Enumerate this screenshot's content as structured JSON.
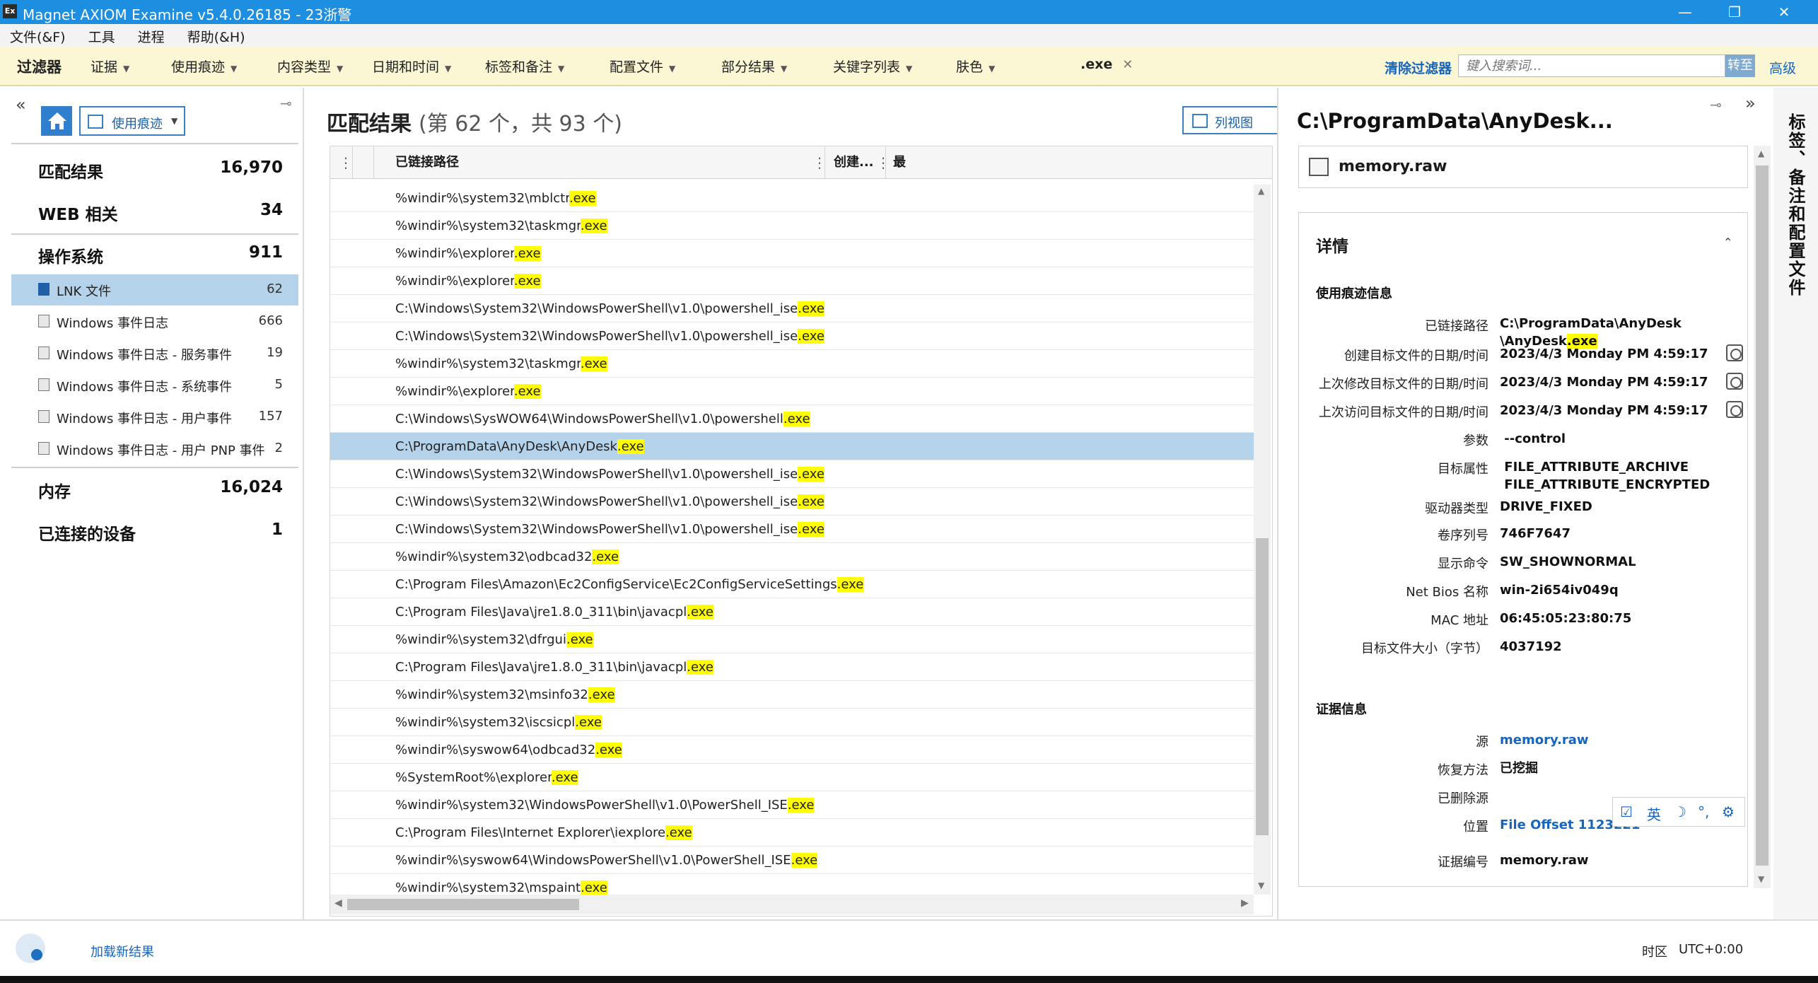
{
  "window": {
    "title": "Magnet AXIOM Examine v5.4.0.26185 - 23浙警",
    "icon_text": "Ex",
    "controls": [
      "—",
      "❐",
      "✕"
    ]
  },
  "menu": [
    "文件(&F)",
    "工具",
    "进程",
    "帮助(&H)"
  ],
  "filterbar": {
    "title": "过滤器",
    "filters": [
      "证据",
      "使用痕迹",
      "内容类型",
      "日期和时间",
      "标签和备注",
      "配置文件",
      "部分结果",
      "关键字列表",
      "肤色"
    ],
    "active_filter": ".exe",
    "clear_label": "清除过滤器",
    "search_placeholder": "键入搜索词...",
    "search_button": "转至",
    "advanced_label": "高级"
  },
  "left": {
    "view_label": "使用痕迹",
    "categories": [
      {
        "label": "匹配结果",
        "count": "16,970"
      },
      {
        "label": "WEB 相关",
        "count": "34"
      },
      {
        "label": "操作系统",
        "count": "911"
      }
    ],
    "artifacts": [
      {
        "label": "LNK 文件",
        "count": "62",
        "selected": true
      },
      {
        "label": "Windows 事件日志",
        "count": "666"
      },
      {
        "label": "Windows 事件日志 - 服务事件",
        "count": "19"
      },
      {
        "label": "Windows 事件日志 - 系统事件",
        "count": "5"
      },
      {
        "label": "Windows 事件日志 - 用户事件",
        "count": "157"
      },
      {
        "label": "Windows 事件日志 - 用户 PNP 事件",
        "count": "2"
      }
    ],
    "more_categories": [
      {
        "label": "内存",
        "count": "16,024"
      },
      {
        "label": "已连接的设备",
        "count": "1"
      }
    ]
  },
  "results": {
    "title": "匹配结果",
    "subtitle": "(第 62 个，共 93 个)",
    "column_view": "列视图",
    "columns": [
      "已链接路径",
      "创建...",
      "最"
    ],
    "rows": [
      {
        "prefix": "%windir%\\system32\\mblctr",
        "hl": ".exe"
      },
      {
        "prefix": "%windir%\\system32\\taskmgr",
        "hl": ".exe"
      },
      {
        "prefix": "%windir%\\explorer",
        "hl": ".exe"
      },
      {
        "prefix": "%windir%\\explorer",
        "hl": ".exe"
      },
      {
        "prefix": "C:\\Windows\\System32\\WindowsPowerShell\\v1.0\\powershell_ise",
        "hl": ".exe"
      },
      {
        "prefix": "C:\\Windows\\System32\\WindowsPowerShell\\v1.0\\powershell_ise",
        "hl": ".exe"
      },
      {
        "prefix": "%windir%\\system32\\taskmgr",
        "hl": ".exe"
      },
      {
        "prefix": "%windir%\\explorer",
        "hl": ".exe"
      },
      {
        "prefix": "C:\\Windows\\SysWOW64\\WindowsPowerShell\\v1.0\\powershell",
        "hl": ".exe"
      },
      {
        "prefix": "C:\\ProgramData\\AnyDesk\\AnyDesk",
        "hl": ".exe",
        "selected": true
      },
      {
        "prefix": "C:\\Windows\\System32\\WindowsPowerShell\\v1.0\\powershell_ise",
        "hl": ".exe"
      },
      {
        "prefix": "C:\\Windows\\System32\\WindowsPowerShell\\v1.0\\powershell_ise",
        "hl": ".exe"
      },
      {
        "prefix": "C:\\Windows\\System32\\WindowsPowerShell\\v1.0\\powershell_ise",
        "hl": ".exe"
      },
      {
        "prefix": "%windir%\\system32\\odbcad32",
        "hl": ".exe"
      },
      {
        "prefix": "C:\\Program Files\\Amazon\\Ec2ConfigService\\Ec2ConfigServiceSettings",
        "hl": ".exe"
      },
      {
        "prefix": "C:\\Program Files\\Java\\jre1.8.0_311\\bin\\javacpl",
        "hl": ".exe"
      },
      {
        "prefix": "%windir%\\system32\\dfrgui",
        "hl": ".exe"
      },
      {
        "prefix": "C:\\Program Files\\Java\\jre1.8.0_311\\bin\\javacpl",
        "hl": ".exe"
      },
      {
        "prefix": "%windir%\\system32\\msinfo32",
        "hl": ".exe"
      },
      {
        "prefix": "%windir%\\system32\\iscsicpl",
        "hl": ".exe"
      },
      {
        "prefix": "%windir%\\syswow64\\odbcad32",
        "hl": ".exe"
      },
      {
        "prefix": "%SystemRoot%\\explorer",
        "hl": ".exe"
      },
      {
        "prefix": "%windir%\\system32\\WindowsPowerShell\\v1.0\\PowerShell_ISE",
        "hl": ".exe"
      },
      {
        "prefix": "C:\\Program Files\\Internet Explorer\\iexplore",
        "hl": ".exe"
      },
      {
        "prefix": "%windir%\\syswow64\\WindowsPowerShell\\v1.0\\PowerShell_ISE",
        "hl": ".exe"
      },
      {
        "prefix": "%windir%\\system32\\mspaint",
        "hl": ".exe"
      }
    ]
  },
  "detail": {
    "title": "C:\\ProgramData\\AnyDesk...",
    "file_name": "memory.raw",
    "heading": "详情",
    "usage_section": "使用痕迹信息",
    "evidence_section": "证据信息",
    "linked_path_label": "已链接路径",
    "linked_path_line1": "C:\\ProgramData\\AnyDesk",
    "linked_path_line2_prefix": "\\AnyDesk",
    "linked_path_line2_hl": ".exe",
    "fields": [
      {
        "label": "创建目标文件的日期/时间",
        "value": "2023/4/3 Monday PM 4:59:17",
        "clock": true
      },
      {
        "label": "上次修改目标文件的日期/时间",
        "value": "2023/4/3 Monday PM 4:59:17",
        "clock": true
      },
      {
        "label": "上次访问目标文件的日期/时间",
        "value": "2023/4/3 Monday PM 4:59:17",
        "clock": true
      },
      {
        "label": "参数",
        "value": " --control"
      },
      {
        "label": "目标属性",
        "value": " FILE_ATTRIBUTE_ARCHIVE\n FILE_ATTRIBUTE_ENCRYPTED"
      },
      {
        "label": "驱动器类型",
        "value": "DRIVE_FIXED"
      },
      {
        "label": "卷序列号",
        "value": "746F7647"
      },
      {
        "label": "显示命令",
        "value": "SW_SHOWNORMAL"
      },
      {
        "label": "Net Bios 名称",
        "value": "win-2i654iv049q"
      },
      {
        "label": "MAC 地址",
        "value": "06:45:05:23:80:75"
      },
      {
        "label": "目标文件大小（字节）",
        "value": "4037192"
      }
    ],
    "evidence_fields": [
      {
        "label": "源",
        "value": "memory.raw",
        "link": true
      },
      {
        "label": "恢复方法",
        "value": "已挖掘"
      },
      {
        "label": "已删除源",
        "value": ""
      },
      {
        "label": "位置",
        "value": "File Offset 1123221",
        "link": true
      },
      {
        "label": "证据编号",
        "value": "memory.raw"
      }
    ]
  },
  "ime": [
    "☑",
    "英",
    "☽",
    "°,",
    "⚙"
  ],
  "sidetab": "标签、备注和配置文件",
  "status": {
    "load_new": "加载新结果",
    "tz_label": "时区",
    "tz_value": "UTC+0:00"
  }
}
